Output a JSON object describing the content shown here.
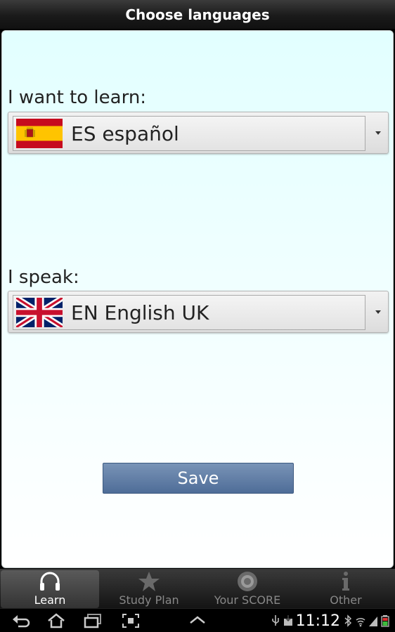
{
  "header": {
    "title": "Choose languages"
  },
  "learn": {
    "label": "I want to learn:",
    "selected": "ES español",
    "flag_icon": "spain-flag-icon"
  },
  "speak": {
    "label": "I speak:",
    "selected": "EN English UK",
    "flag_icon": "uk-flag-icon"
  },
  "save_button": {
    "label": "Save"
  },
  "tabs": [
    {
      "label": "Learn",
      "icon": "headphones-icon",
      "active": true
    },
    {
      "label": "Study Plan",
      "icon": "star-icon",
      "active": false
    },
    {
      "label": "Your SCORE",
      "icon": "target-icon",
      "active": false
    },
    {
      "label": "Other",
      "icon": "info-icon",
      "active": false
    }
  ],
  "status_bar": {
    "time": "11:12"
  },
  "colors": {
    "content_bg": "#e2ffff",
    "save_button": "#5f7ea8",
    "title_bar": "#1a1a1a"
  }
}
